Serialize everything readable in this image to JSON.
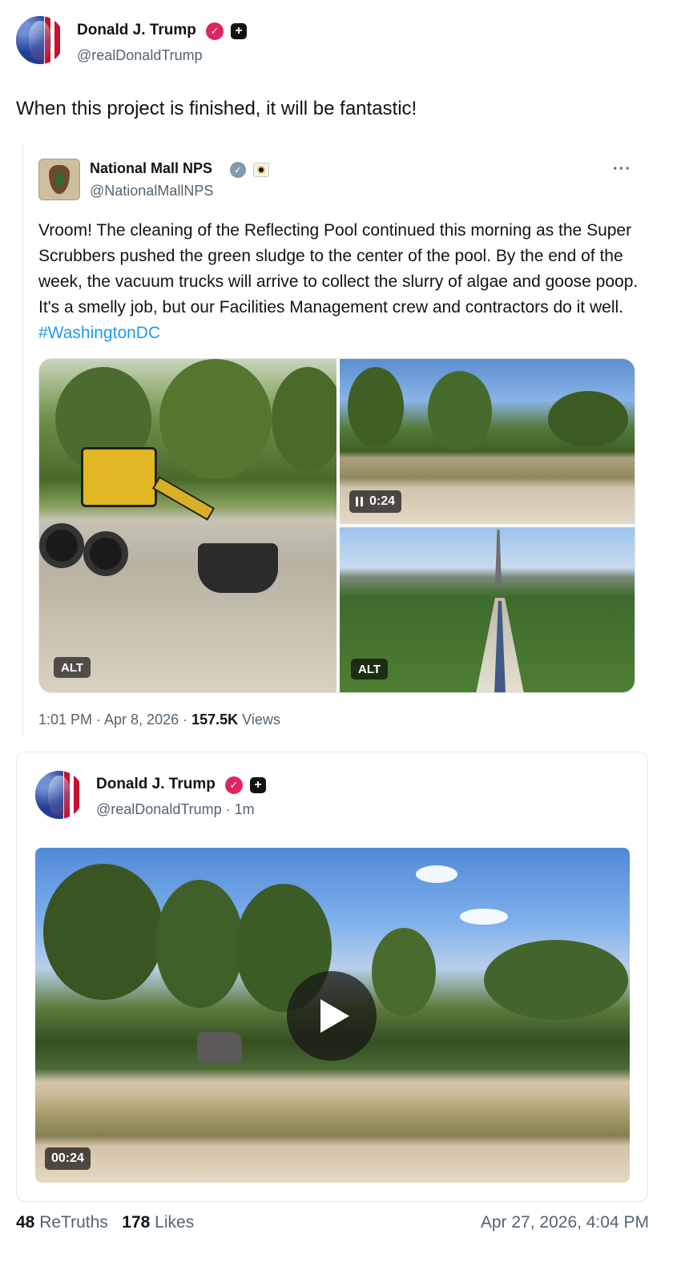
{
  "post": {
    "author_name": "Donald J. Trump",
    "author_handle": "@realDonaldTrump",
    "text": "When this project is finished, it will be fantastic!"
  },
  "quoted_post": {
    "author_name": "National Mall NPS",
    "author_handle": "@NationalMallNPS",
    "text": "Vroom! The cleaning of the Reflecting Pool continued this morning as the Super Scrubbers pushed the green sludge to the center of the pool. By the end of the week, the vacuum trucks will arrive to collect the slurry of algae and goose poop. It's a smelly job, but our Facilities Management crew and contractors do it well.",
    "hashtag": "#WashingtonDC",
    "media": {
      "alt_label": "ALT",
      "video_duration": "0:24"
    },
    "time": "1:01 PM · Apr 8, 2026 · ",
    "views_count": "157.5K",
    "views_label": " Views"
  },
  "embedded_post": {
    "author_name": "Donald J. Trump",
    "author_handle": "@realDonaldTrump · 1m",
    "video_duration": "00:24"
  },
  "footer": {
    "retruths_count": "48",
    "retruths_label": " ReTruths",
    "likes_count": "178",
    "likes_label": " Likes",
    "timestamp": "Apr 27, 2026, 4:04 PM"
  },
  "icons": {
    "verified": "verified-check-icon",
    "plus": "plus-badge-icon",
    "more": "more-options-icon",
    "play": "play-icon",
    "pause": "pause-icon"
  },
  "colors": {
    "text": "#0f1419",
    "muted": "#536471",
    "hashtag": "#1d9bf0",
    "verified_badge": "#e0245e"
  }
}
